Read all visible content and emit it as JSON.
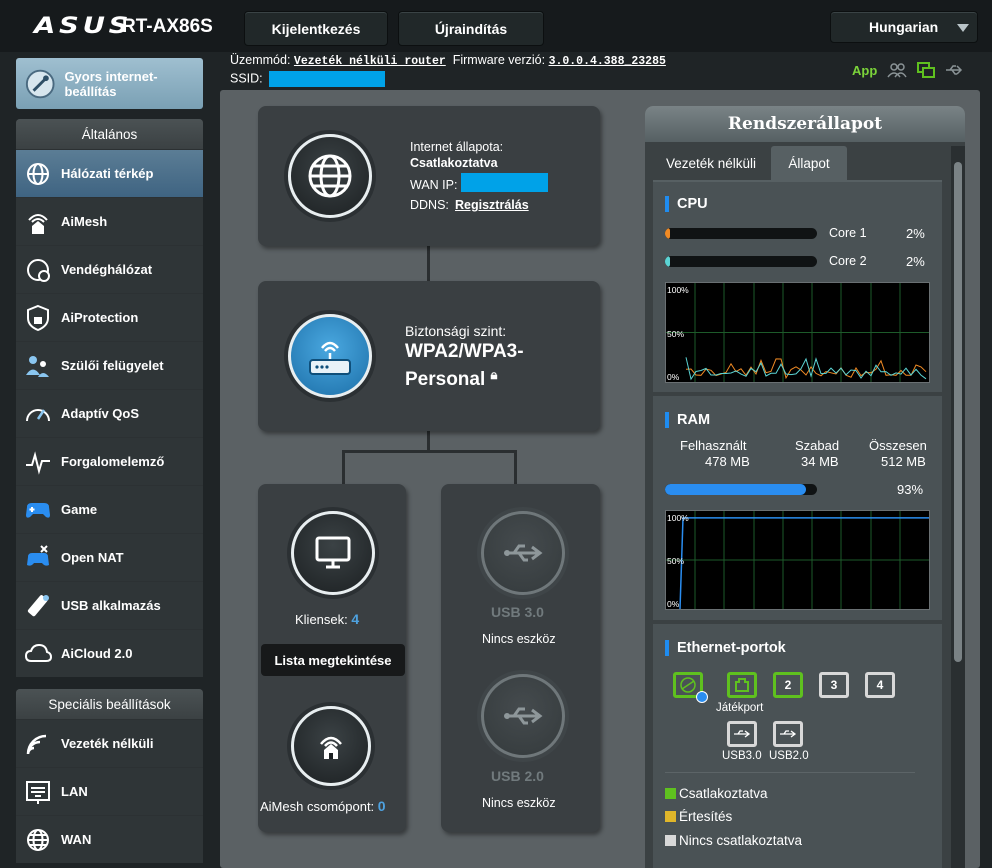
{
  "header": {
    "brand": "ASUS",
    "model": "RT-AX86S",
    "login_label": "Kijelentkezés",
    "reboot_label": "Újraindítás",
    "language": "Hungarian"
  },
  "info": {
    "mode_label": "Üzemmód:",
    "mode_value": "Vezeték nélküli router",
    "firmware_label": "Firmware verzió:",
    "firmware_value": "3.0.0.4.388_23285",
    "ssid_label": "SSID:",
    "app_label": "App"
  },
  "sidebar": {
    "quick_setup": "Gyors internet-beállítás",
    "general_title": "Általános",
    "general_items": [
      {
        "label": "Hálózati térkép",
        "icon": "globe-icon"
      },
      {
        "label": "AiMesh",
        "icon": "aimesh-icon"
      },
      {
        "label": "Vendéghálózat",
        "icon": "guest-network-icon"
      },
      {
        "label": "AiProtection",
        "icon": "shield-lock-icon"
      },
      {
        "label": "Szülői felügyelet",
        "icon": "parental-icon"
      },
      {
        "label": "Adaptív QoS",
        "icon": "speedometer-icon"
      },
      {
        "label": "Forgalomelemző",
        "icon": "traffic-analyzer-icon"
      },
      {
        "label": "Game",
        "icon": "gamepad-icon"
      },
      {
        "label": "Open NAT",
        "icon": "open-nat-icon"
      },
      {
        "label": "USB alkalmazás",
        "icon": "usb-app-icon"
      },
      {
        "label": "AiCloud 2.0",
        "icon": "cloud-icon"
      }
    ],
    "advanced_title": "Speciális beállítások",
    "advanced_items": [
      {
        "label": "Vezeték nélküli",
        "icon": "wifi-icon"
      },
      {
        "label": "LAN",
        "icon": "lan-icon"
      },
      {
        "label": "WAN",
        "icon": "wan-globe-icon"
      }
    ]
  },
  "map": {
    "internet_status_label": "Internet állapota:",
    "internet_status_value": "Csatlakoztatva",
    "wan_ip_label": "WAN IP:",
    "ddns_label": "DDNS:",
    "ddns_link": "Regisztrálás",
    "security_label": "Biztonsági szint:",
    "security_value_1": "WPA2/WPA3-",
    "security_value_2": "Personal",
    "clients_label": "Kliensek:",
    "clients_count": "4",
    "view_list_button": "Lista megtekintése",
    "aimesh_label": "AiMesh csomópont:",
    "aimesh_count": "0",
    "usb3_label": "USB 3.0",
    "usb3_status": "Nincs eszköz",
    "usb2_label": "USB 2.0",
    "usb2_status": "Nincs eszköz"
  },
  "system_status": {
    "title": "Rendszerállapot",
    "tabs": [
      "Vezeték nélküli",
      "Állapot"
    ],
    "cpu": {
      "title": "CPU",
      "cores": [
        {
          "name": "Core 1",
          "percent_label": "2%",
          "percent": 2,
          "color": "#f08a24"
        },
        {
          "name": "Core 2",
          "percent_label": "2%",
          "percent": 2,
          "color": "#5bd4d4"
        }
      ],
      "graph_labels": [
        "100%",
        "50%",
        "0%"
      ]
    },
    "ram": {
      "title": "RAM",
      "used_label": "Felhasznált",
      "free_label": "Szabad",
      "total_label": "Összesen",
      "used_value": "478 MB",
      "free_value": "34 MB",
      "total_value": "512 MB",
      "percent_label": "93%",
      "percent": 93,
      "graph_labels": [
        "100%",
        "50%",
        "0%"
      ]
    },
    "ethernet": {
      "title": "Ethernet-portok",
      "ports": [
        "2",
        "3",
        "4"
      ],
      "game_port_label": "Játékport",
      "usb3_label": "USB3.0",
      "usb2_label": "USB2.0",
      "legend": [
        {
          "label": "Csatlakoztatva",
          "color": "#5fc11f"
        },
        {
          "label": "Értesítés",
          "color": "#e0b62a"
        },
        {
          "label": "Nincs csatlakoztatva",
          "color": "#d8d8d8"
        }
      ]
    }
  }
}
